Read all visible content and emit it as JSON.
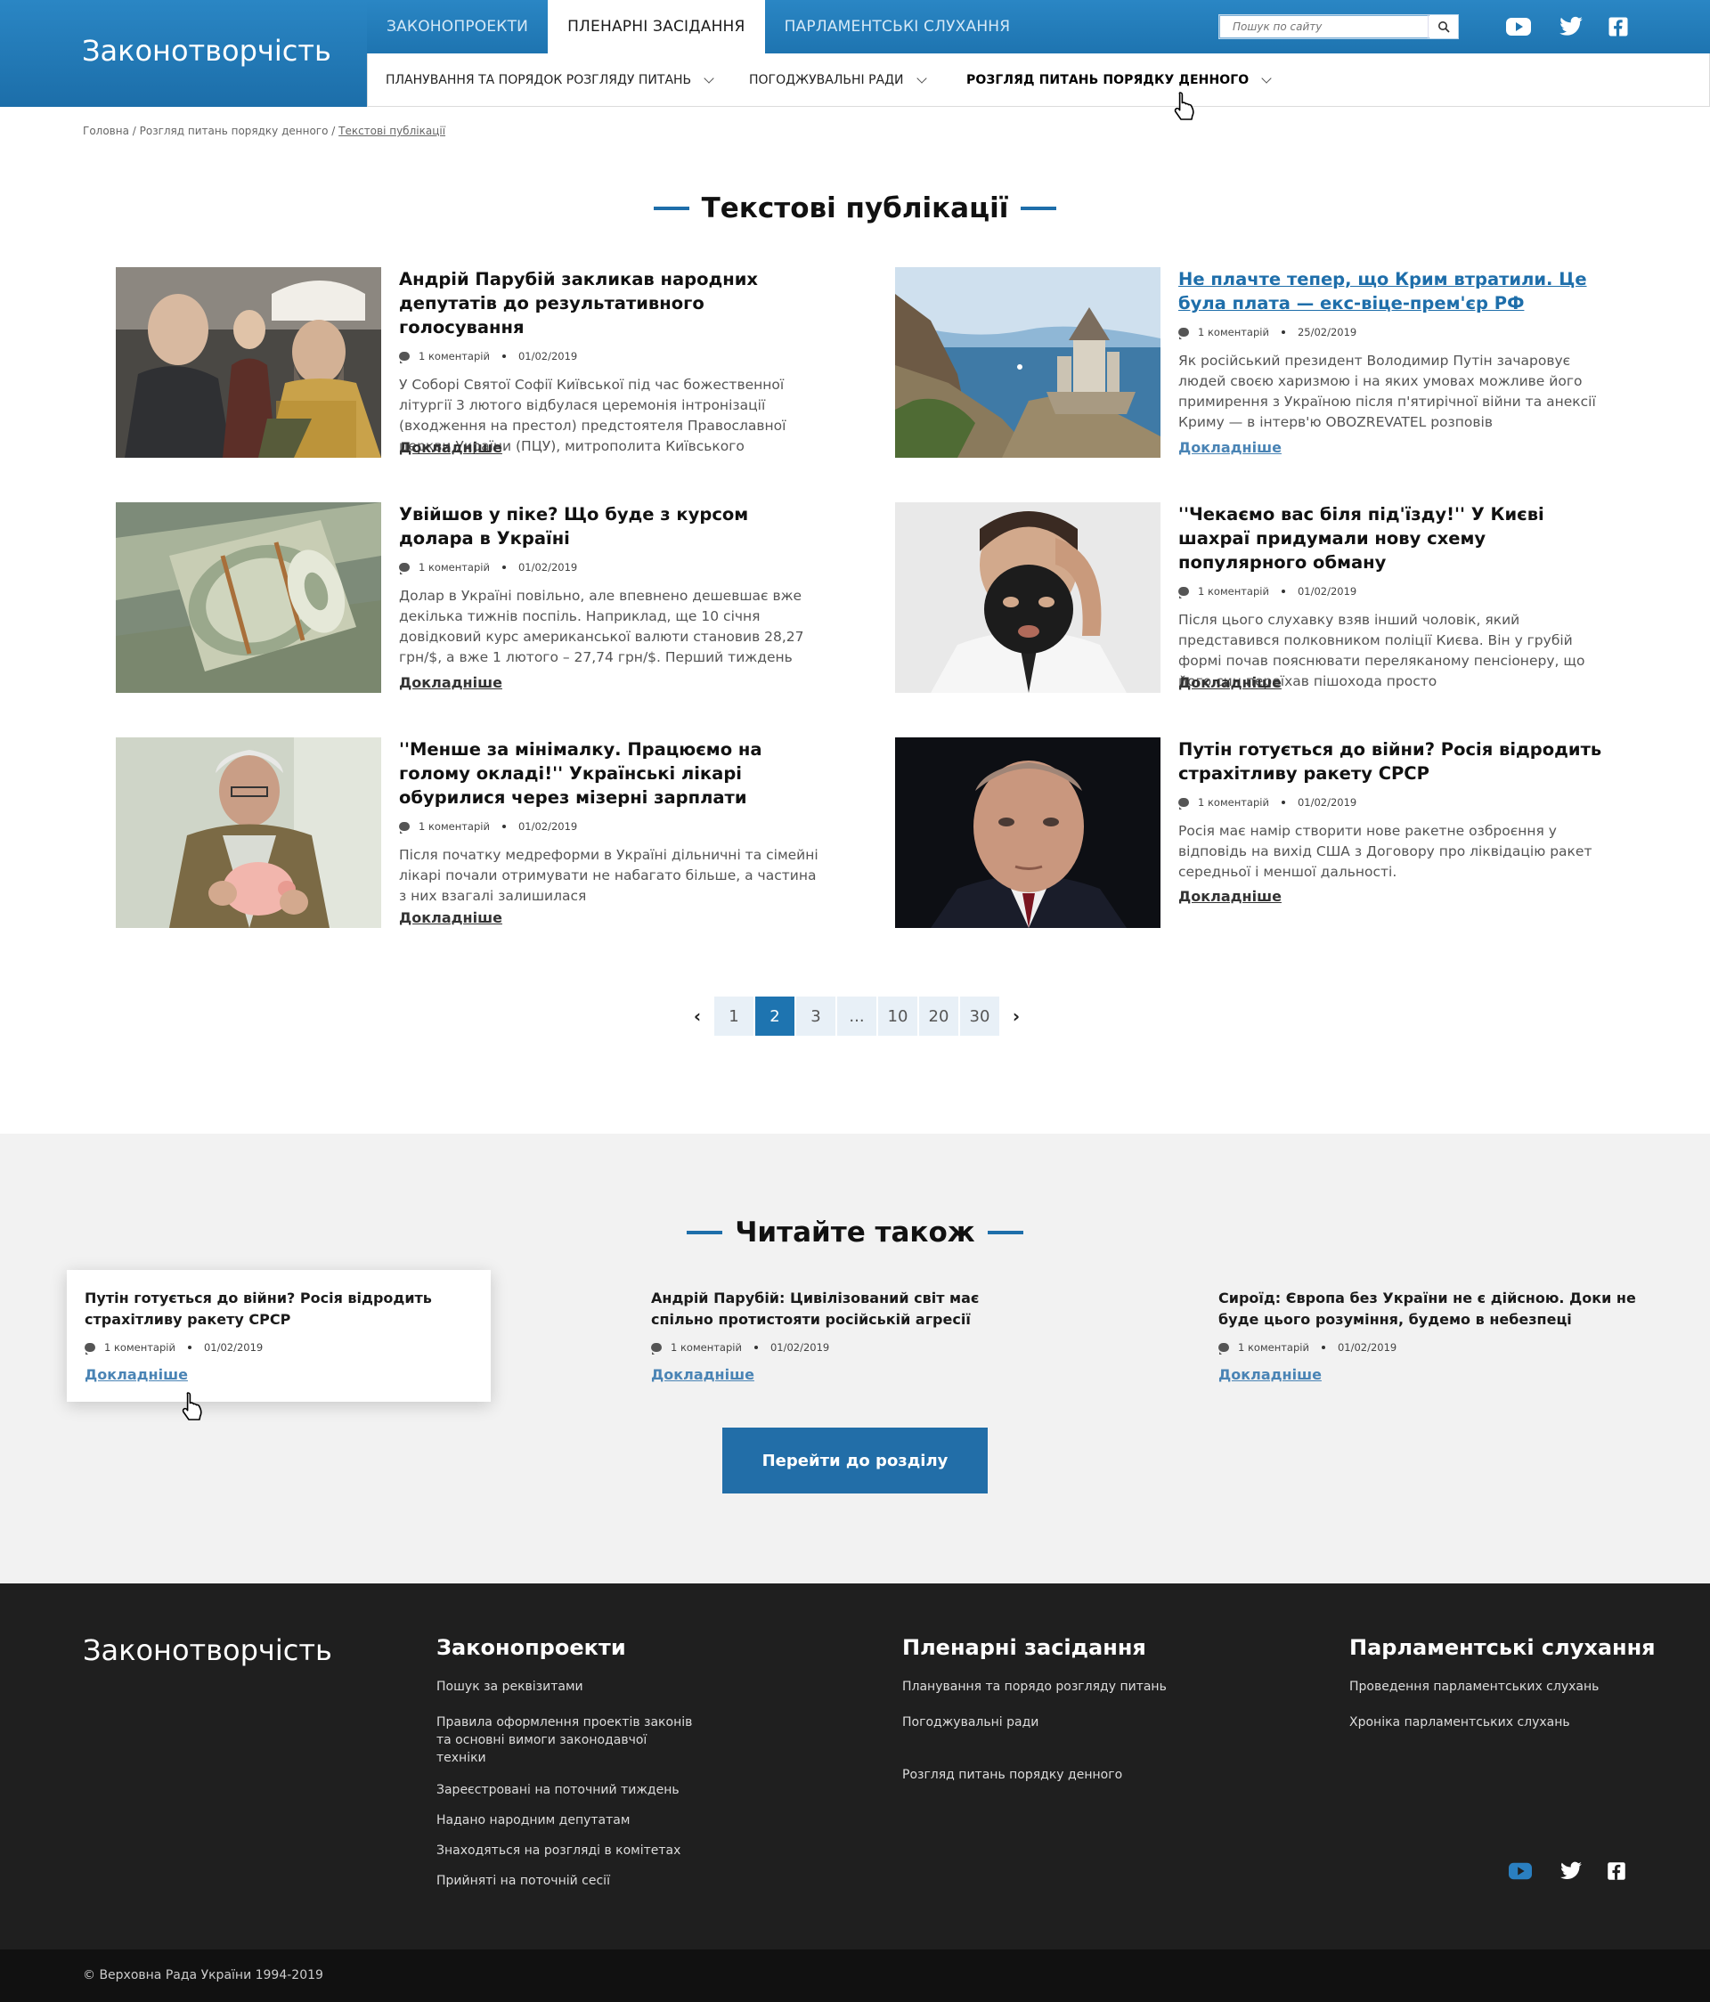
{
  "header": {
    "brand": "Законотворчість",
    "tabs": [
      {
        "label": "ЗАКОНОПРОЕКТИ"
      },
      {
        "label": "ПЛЕНАРНІ ЗАСІДАННЯ"
      },
      {
        "label": "ПАРЛАМЕНТСЬКІ СЛУХАННЯ"
      }
    ],
    "search_placeholder": "Пошук по сайту",
    "subnav": [
      {
        "label": "ПЛАНУВАННЯ ТА ПОРЯДОК РОЗГЛЯДУ ПИТАНЬ"
      },
      {
        "label": "ПОГОДЖУВАЛЬНІ РАДИ"
      },
      {
        "label": "РОЗГЛЯД ПИТАНЬ ПОРЯДКУ ДЕННОГО"
      }
    ],
    "social_icons": [
      "youtube-icon",
      "twitter-icon",
      "facebook-icon"
    ]
  },
  "breadcrumb": {
    "items": [
      "Головна",
      "Розгляд питань порядку денного"
    ],
    "current": "Текстові публікації",
    "separator": " / "
  },
  "main": {
    "title": "Текстові публікації",
    "more_label": "Докладніше",
    "articles": [
      {
        "title": "Андрій Парубій закликав народних депутатів до результативного голосування",
        "comments": "1 коментарій",
        "date": "01/02/2019",
        "excerpt": "У Соборі Святої Софії Київської під час божественної літургії 3 лютого відбулася церемонія інтронізації (входження на престол) предстоятеля Православної церкви України (ПЦУ), митрополита Київського"
      },
      {
        "title": "Не плачте тепер, що Крим втратили. Це була плата — екс-віце-прем'єр РФ",
        "comments": "1 коментарій",
        "date": "25/02/2019",
        "excerpt": "Як російський президент Володимир Путін зачаровує людей своєю харизмою і на яких умовах можливе його примирення з Україною після п'ятирічної війни та анексії Криму — в інтерв'ю OBOZREVATEL розповів"
      },
      {
        "title": "Увійшов у піке? Що буде з курсом долара в Україні",
        "comments": "1 коментарій",
        "date": "01/02/2019",
        "excerpt": "Долар в Україні повільно, але впевнено дешевшає вже декілька тижнів поспіль. Наприклад, ще 10 січня довідковий курс американської валюти становив 28,27 грн/$, а вже 1 лютого – 27,74 грн/$. Перший тиждень"
      },
      {
        "title": "''Чекаємо вас біля під'їзду!'' У Києві шахраї придумали нову схему популярного обману",
        "comments": "1 коментарій",
        "date": "01/02/2019",
        "excerpt": "Після цього слухавку взяв інший чоловік, який представився полковником поліції Києва. Він у грубій формі почав пояснювати переляканому пенсіонеру, що його син переїхав пішохода просто"
      },
      {
        "title": "''Менше за мінімалку. Працюємо на голому окладі!'' Українські лікарі обурилися через мізерні зарплати",
        "comments": "1 коментарій",
        "date": "01/02/2019",
        "excerpt": "Після початку медреформи в Україні дільничні та сімейні лікарі почали отримувати не набагато більше, а частина з них взагалі залишилася"
      },
      {
        "title": "Путін готується до війни? Росія відродить страхітливу ракету СРСР",
        "comments": "1 коментарій",
        "date": "01/02/2019",
        "excerpt": "Росія має намір створити нове ракетне озброєння у відповідь на вихід США з Договору про ліквідацію ракет середньої і меншої дальності."
      }
    ]
  },
  "pagination": {
    "prev": "‹",
    "next": "›",
    "pages": [
      "1",
      "2",
      "3",
      "...",
      "10",
      "20",
      "30"
    ],
    "current": "2"
  },
  "read_also": {
    "title": "Читайте також",
    "more_label": "Докладніше",
    "button_label": "Перейти до розділу",
    "cards": [
      {
        "title": "Путін готується до війни? Росія відродить страхітливу ракету СРСР",
        "comments": "1 коментарій",
        "date": "01/02/2019"
      },
      {
        "title": "Андрій Парубій: Цивілізований світ має спільно протистояти російській агресії",
        "comments": "1 коментарій",
        "date": "01/02/2019"
      },
      {
        "title": "Сироїд: Європа без України не є дійсною. Доки не буде цього розуміння, будемо в небезпеці",
        "comments": "1 коментарій",
        "date": "01/02/2019"
      }
    ]
  },
  "footer": {
    "brand": "Законотворчість",
    "columns": [
      {
        "title": "Законопроекти",
        "links": [
          "Пошук за реквізитами",
          "Правила оформлення проектів законів та основні вимоги законодавчої техніки",
          "Зареєстровані на поточний тиждень",
          "Надано народним депутатам",
          "Знаходяться на розгляді в комітетах",
          "Прийняті на поточній сесії"
        ]
      },
      {
        "title": "Пленарні засідання",
        "links": [
          "Планування та порядо розгляду питань",
          "Погоджувальні ради",
          "Розгляд питань порядку денного"
        ]
      },
      {
        "title": "Парламентські слухання",
        "links": [
          "Проведення парламентських слухань",
          "Хроніка парламентських слухань"
        ]
      }
    ],
    "copyright": "© Верховна Рада України 1994-2019"
  },
  "colors": {
    "brand_blue": "#1e74b0",
    "link_blue": "#1e6eaa",
    "footer_bg": "#1f1f1f"
  }
}
